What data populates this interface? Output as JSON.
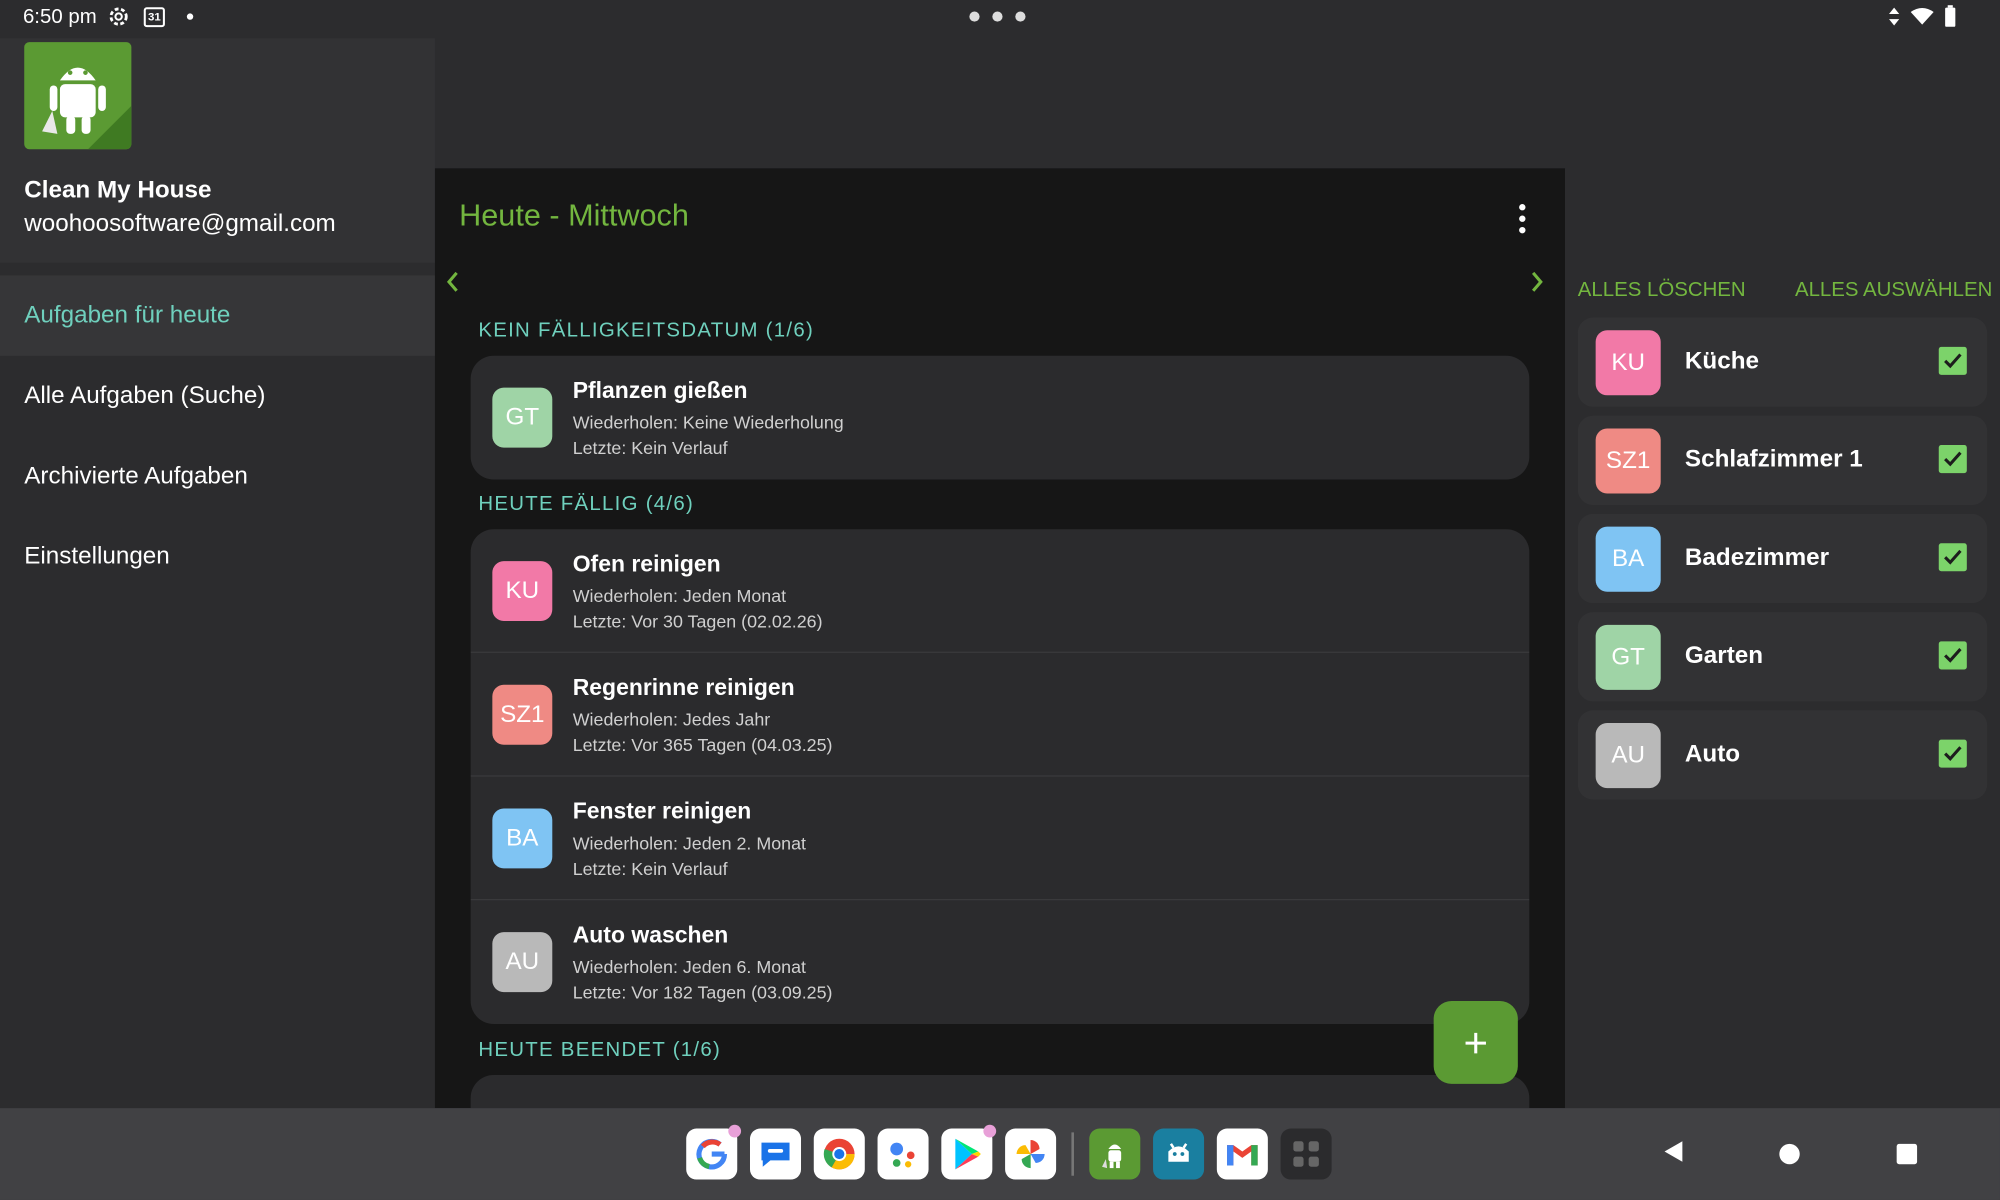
{
  "status": {
    "time": "6:50 pm",
    "calendar_day": "31"
  },
  "drawer": {
    "app_name": "Clean My House",
    "email": "woohoosoftware@gmail.com",
    "menu": [
      {
        "label": "Aufgaben für heute",
        "active": true
      },
      {
        "label": "Alle Aufgaben (Suche)",
        "active": false
      },
      {
        "label": "Archivierte Aufgaben",
        "active": false
      },
      {
        "label": "Einstellungen",
        "active": false
      }
    ]
  },
  "main": {
    "title": "Heute - Mittwoch",
    "sections": [
      {
        "header": "KEIN FÄLLIGKEITSDATUM (1/6)",
        "tasks": [
          {
            "badge": "GT",
            "color": "#9fd4a6",
            "title": "Pflanzen gießen",
            "repeat": "Wiederholen: Keine Wiederholung",
            "last": "Letzte: Kein Verlauf"
          }
        ]
      },
      {
        "header": "HEUTE FÄLLIG (4/6)",
        "tasks": [
          {
            "badge": "KU",
            "color": "#f279a7",
            "title": "Ofen reinigen",
            "repeat": "Wiederholen: Jeden Monat",
            "last": "Letzte: Vor 30 Tagen (02.02.26)"
          },
          {
            "badge": "SZ1",
            "color": "#ef8a84",
            "title": "Regenrinne reinigen",
            "repeat": "Wiederholen: Jedes Jahr",
            "last": "Letzte: Vor 365 Tagen (04.03.25)"
          },
          {
            "badge": "BA",
            "color": "#7fc4f3",
            "title": "Fenster reinigen",
            "repeat": "Wiederholen: Jeden 2. Monat",
            "last": "Letzte: Kein Verlauf"
          },
          {
            "badge": "AU",
            "color": "#b9b9b9",
            "title": "Auto waschen",
            "repeat": "Wiederholen: Jeden 6. Monat",
            "last": "Letzte: Vor 182 Tagen (03.09.25)"
          }
        ]
      },
      {
        "header": "HEUTE BEENDET (1/6)"
      }
    ]
  },
  "filters": {
    "clear_all": "ALLES LÖSCHEN",
    "select_all": "ALLES AUSWÄHLEN",
    "items": [
      {
        "badge": "KU",
        "color": "#f279a7",
        "label": "Küche",
        "checked": true
      },
      {
        "badge": "SZ1",
        "color": "#ef8a84",
        "label": "Schlafzimmer 1",
        "checked": true
      },
      {
        "badge": "BA",
        "color": "#7fc4f3",
        "label": "Badezimmer",
        "checked": true
      },
      {
        "badge": "GT",
        "color": "#9fd4a6",
        "label": "Garten",
        "checked": true
      },
      {
        "badge": "AU",
        "color": "#b9b9b9",
        "label": "Auto",
        "checked": true
      }
    ]
  },
  "taskbar": {
    "apps": [
      "google-icon",
      "messages-icon",
      "chrome-icon",
      "assistant-icon",
      "play-store-icon",
      "photos-icon",
      "clean-my-house-icon",
      "fdroid-icon",
      "gmail-icon",
      "app-drawer-icon"
    ]
  }
}
